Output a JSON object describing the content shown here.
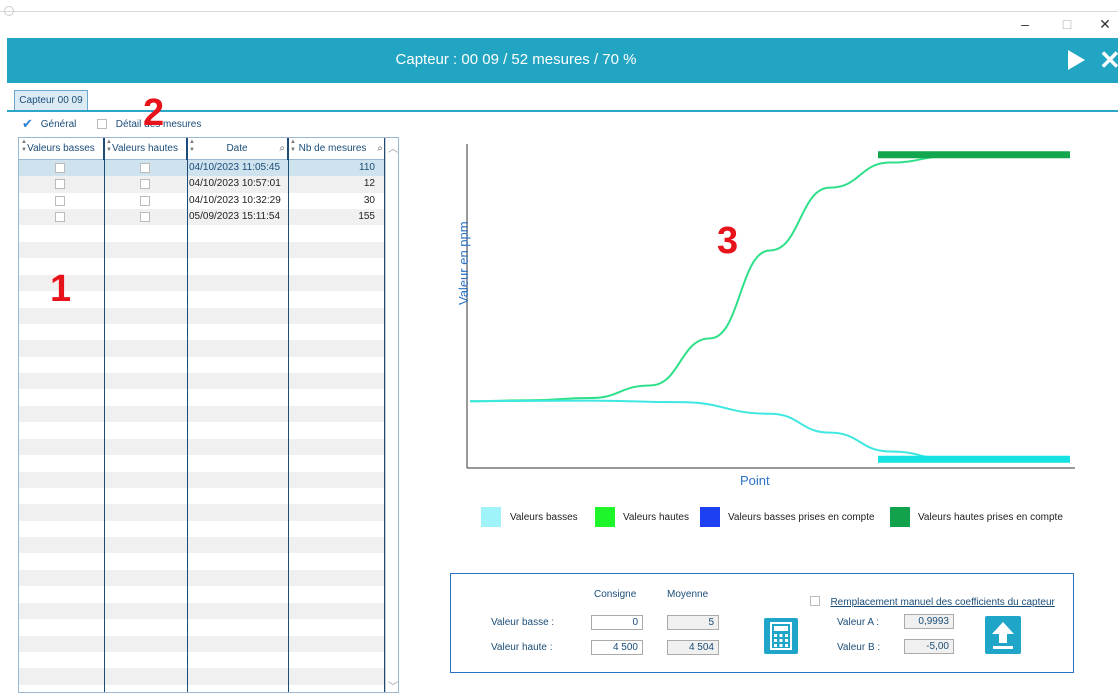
{
  "window": {
    "minimize_glyph": "–",
    "maximize_glyph": "□",
    "close_glyph": "✕"
  },
  "banner": {
    "title": "Capteur : 00 09 / 52 mesures / 70 %",
    "play_icon": "play-icon",
    "close_icon": "close-icon",
    "close_glyph": "✕",
    "color": "#22a4c3"
  },
  "tab": {
    "label": "Capteur 00 09"
  },
  "options": {
    "general_label": "Général",
    "general_checked": true,
    "detail_label": "Détail des mesures",
    "detail_checked": false
  },
  "grid": {
    "columns": [
      "Valeurs basses",
      "Valeurs hautes",
      "Date",
      "Nb de mesures"
    ],
    "rows": [
      {
        "date": "04/10/2023 11:05:45",
        "count": "110",
        "selected": true
      },
      {
        "date": "04/10/2023 10:57:01",
        "count": "12",
        "selected": false
      },
      {
        "date": "04/10/2023 10:32:29",
        "count": "30",
        "selected": false
      },
      {
        "date": "05/09/2023 15:11:54",
        "count": "155",
        "selected": false
      }
    ],
    "empty_rows": 28
  },
  "annotations": {
    "one": "1",
    "two": "2",
    "three": "3"
  },
  "chart_data": {
    "type": "line",
    "xlabel": "Point",
    "ylabel": "Valeur en ppm",
    "grid": false,
    "series": [
      {
        "name": "Valeurs hautes",
        "color": "#2fe08a",
        "points": [
          [
            0,
            20
          ],
          [
            10,
            20.3
          ],
          [
            20,
            21
          ],
          [
            30,
            25
          ],
          [
            40,
            40
          ],
          [
            50,
            68
          ],
          [
            60,
            88
          ],
          [
            70,
            96
          ],
          [
            80,
            98
          ],
          [
            100,
            98
          ]
        ]
      },
      {
        "name": "Valeurs basses",
        "color": "#3ee7e0",
        "points": [
          [
            0,
            20
          ],
          [
            20,
            20.2
          ],
          [
            35,
            19.7
          ],
          [
            50,
            16
          ],
          [
            60,
            10
          ],
          [
            70,
            4
          ],
          [
            80,
            1.5
          ],
          [
            100,
            1.2
          ]
        ]
      },
      {
        "name": "Valeurs hautes prises en compte",
        "color": "#12a64f",
        "points": [
          [
            68,
            98.5
          ],
          [
            100,
            98.5
          ]
        ]
      },
      {
        "name": "Valeurs basses prises en compte",
        "color": "#15e3e3",
        "points": [
          [
            68,
            1.5
          ],
          [
            100,
            1.5
          ]
        ]
      }
    ],
    "legend": [
      {
        "label": "Valeurs basses",
        "color": "#9ff3f9"
      },
      {
        "label": "Valeurs hautes",
        "color": "#1ef52a"
      },
      {
        "label": "Valeurs basses prises en compte",
        "color": "#1c40f2"
      },
      {
        "label": "Valeurs hautes prises en compte",
        "color": "#11a24b"
      }
    ],
    "legend_position": "bottom"
  },
  "panel": {
    "consigne_header": "Consigne",
    "moyenne_header": "Moyenne",
    "valeur_basse_label": "Valeur basse :",
    "valeur_haute_label": "Valeur haute :",
    "consigne_basse": "0",
    "moyenne_basse": "5",
    "consigne_haute": "4 500",
    "moyenne_haute": "4 504",
    "manual_label": "Remplacement manuel des coefficients du capteur",
    "manual_checked": false,
    "valeur_a_label": "Valeur A :",
    "valeur_a": "0,9993",
    "valeur_b_label": "Valeur B :",
    "valeur_b": "-5,00",
    "calc_icon": "calculator-icon",
    "upload_icon": "upload-icon"
  }
}
